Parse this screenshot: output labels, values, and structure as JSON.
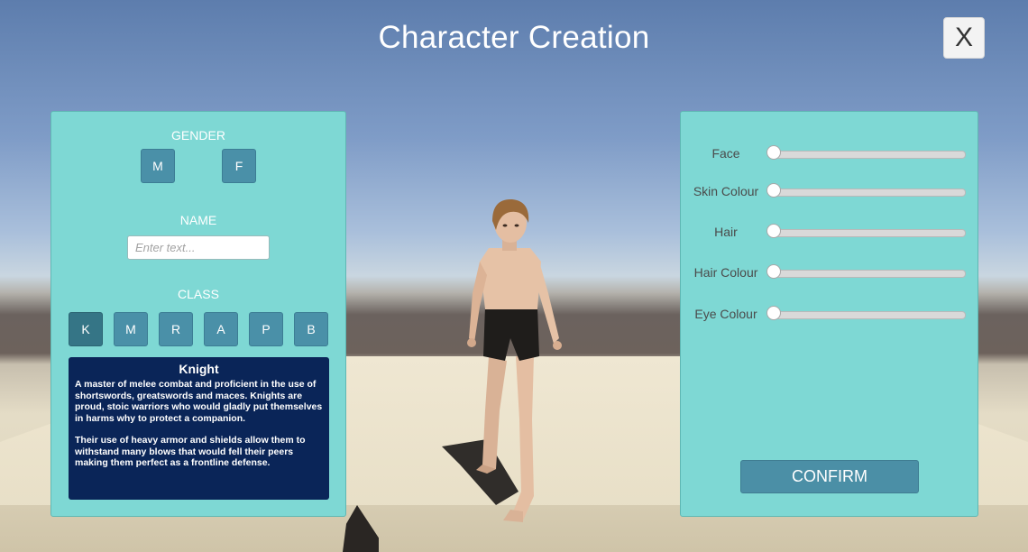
{
  "title": "Character Creation",
  "close_label": "X",
  "left_panel": {
    "gender_label": "GENDER",
    "gender_options": [
      "M",
      "F"
    ],
    "name_label": "NAME",
    "name_placeholder": "Enter text...",
    "class_label": "CLASS",
    "class_options": [
      "K",
      "M",
      "R",
      "A",
      "P",
      "B"
    ],
    "selected_class": "K",
    "description": {
      "title": "Knight",
      "paragraph1": "A master of melee combat and proficient in the use of shortswords,  greatswords and maces. Knights are proud, stoic warriors who would gladly put themselves in harms why to protect a companion.",
      "paragraph2": "Their use of heavy armor and shields allow them to withstand many blows that would fell their peers making them perfect as a frontline defense."
    }
  },
  "right_panel": {
    "sliders": [
      {
        "label": "Face",
        "value": 0
      },
      {
        "label": "Skin Colour",
        "value": 0
      },
      {
        "label": "Hair",
        "value": 0
      },
      {
        "label": "Hair Colour",
        "value": 0
      },
      {
        "label": "Eye Colour",
        "value": 0
      }
    ],
    "confirm_label": "CONFIRM"
  },
  "colors": {
    "panel": "#7ed8d4",
    "button": "#4a90a8",
    "description_bg": "#0a2558"
  }
}
